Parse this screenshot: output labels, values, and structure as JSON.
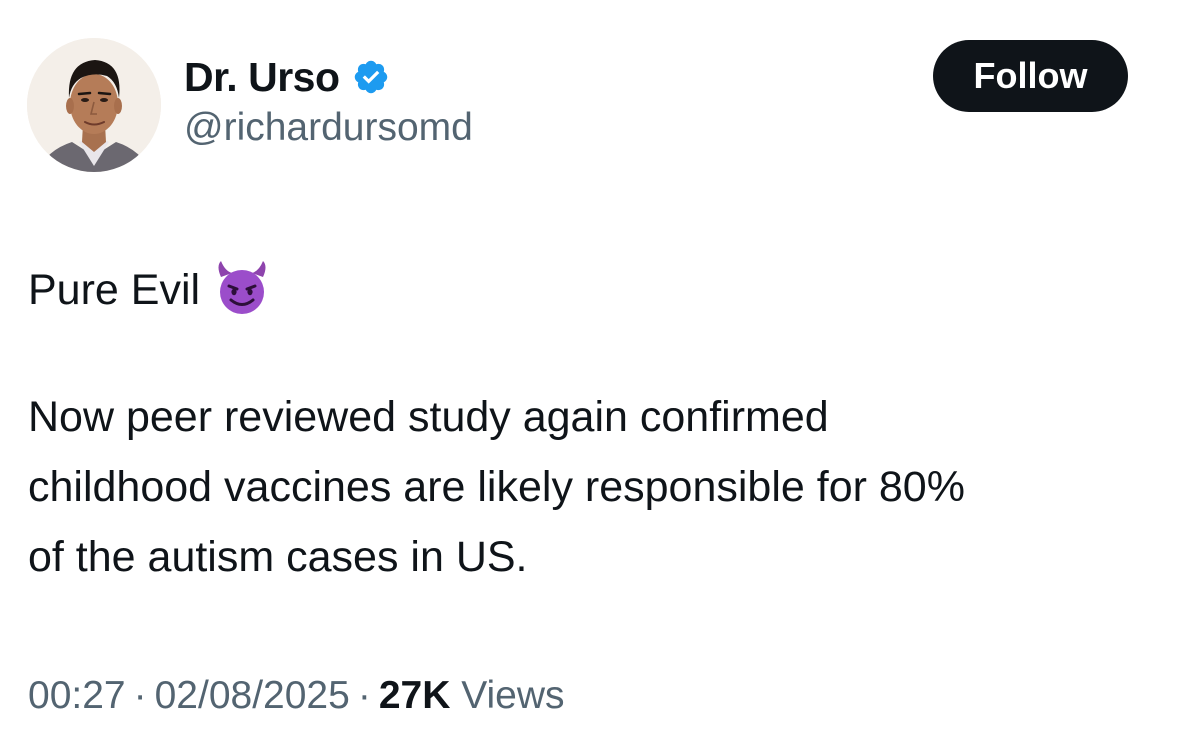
{
  "author": {
    "display_name": "Dr. Urso",
    "handle": "@richardursomd",
    "verified": true,
    "verified_color": "#1d9bf0"
  },
  "follow_button": {
    "label": "Follow"
  },
  "tweet": {
    "lines": [
      "Pure Evil",
      "Now peer reviewed study again confirmed",
      "childhood vaccines are likely responsible for 80%",
      "of the autism cases in US."
    ],
    "emoji": "smiling-face-with-horns"
  },
  "meta": {
    "time": "00:27",
    "separator": "·",
    "date": "02/08/2025",
    "views_count": "27K",
    "views_label": "Views"
  },
  "colors": {
    "text_primary": "#0f1419",
    "text_secondary": "#536471",
    "button_bg": "#0f1419",
    "emoji_purple": "#8e44ad"
  }
}
